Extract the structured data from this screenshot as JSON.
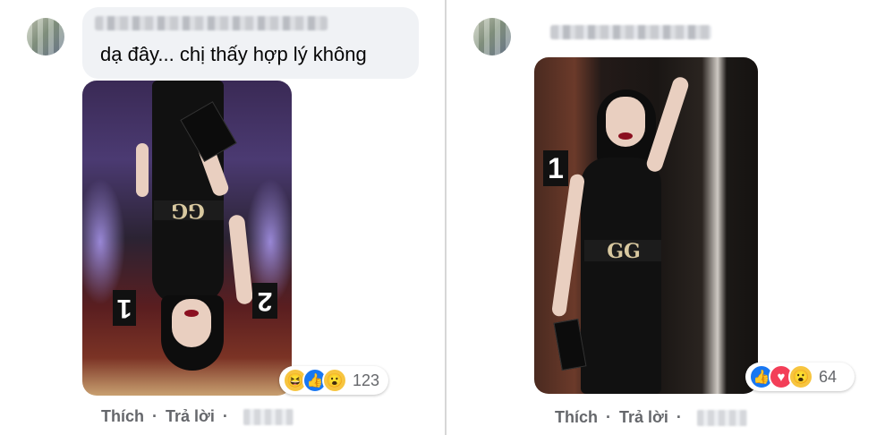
{
  "left_comment": {
    "avatar": "user-avatar-blurred",
    "text": "dạ đây... chị thấy hợp lý không",
    "photo": {
      "sign_number": "1",
      "sign_number_2": "2",
      "buckle": "GG"
    },
    "reactions": {
      "icons": [
        "haha",
        "like",
        "wow"
      ],
      "count": "123"
    },
    "actions": {
      "like": "Thích",
      "separator": "·",
      "reply": "Trả lời"
    }
  },
  "right_comment": {
    "avatar": "user-avatar-blurred",
    "photo": {
      "sign_number": "1",
      "buckle": "GG"
    },
    "reactions": {
      "icons": [
        "like",
        "love",
        "wow"
      ],
      "count": "64"
    },
    "actions": {
      "like": "Thích",
      "separator": "·",
      "reply": "Trả lời"
    }
  },
  "colors": {
    "like_blue": "#1877f2",
    "love_red": "#f33e58",
    "reaction_yellow": "#f7c53f",
    "secondary_text": "#65676b",
    "bubble_bg": "#f0f2f5"
  }
}
